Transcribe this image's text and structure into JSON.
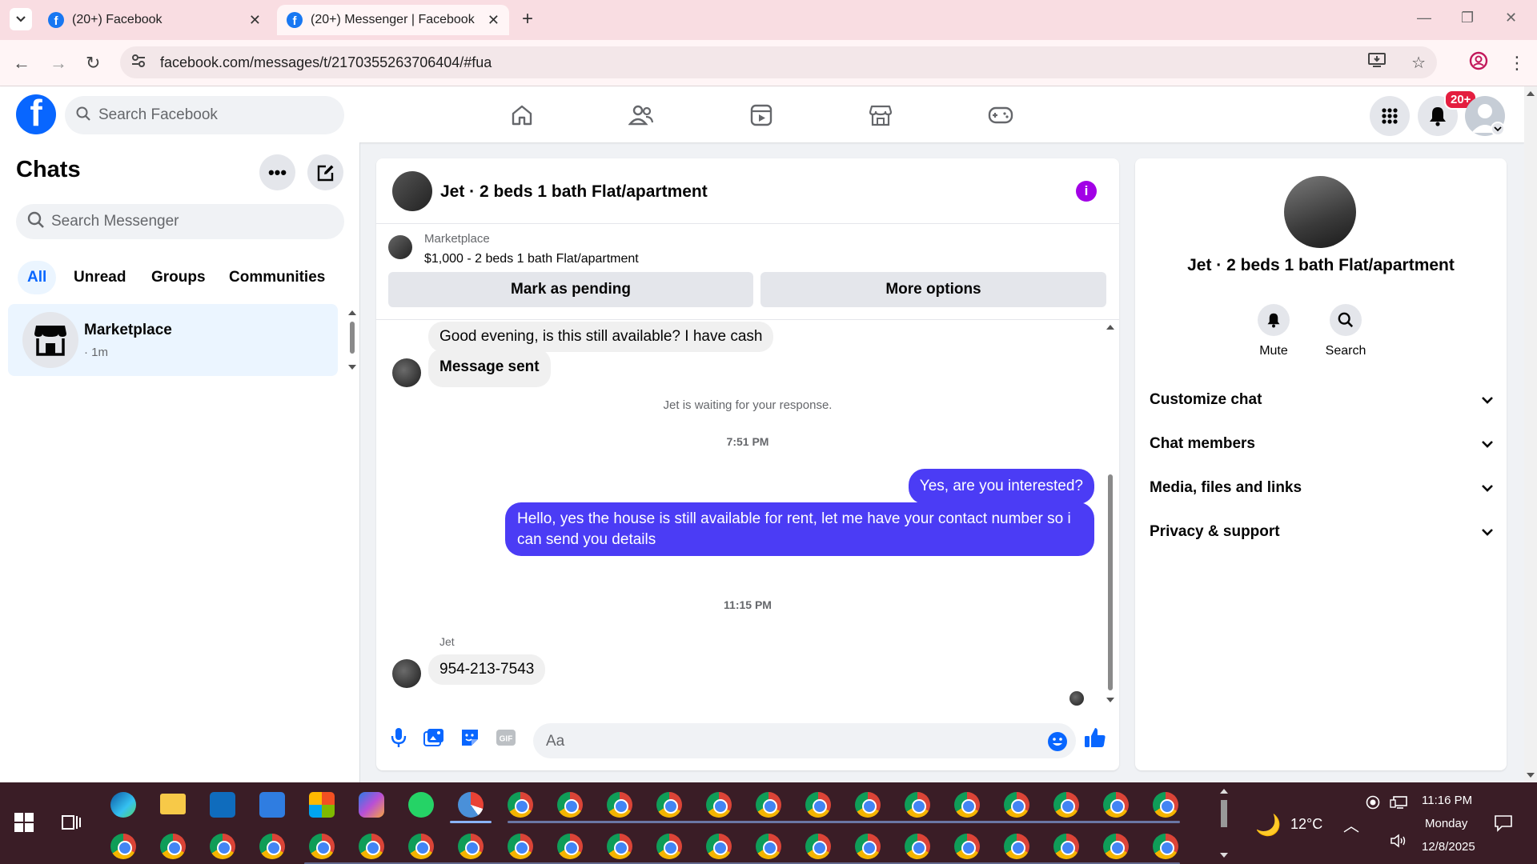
{
  "browser": {
    "tabs": [
      {
        "title": "(20+) Facebook",
        "active": false
      },
      {
        "title": "(20+) Messenger | Facebook",
        "active": true
      }
    ],
    "url": "facebook.com/messages/t/2170355263706404/#fua"
  },
  "header": {
    "search_placeholder": "Search Facebook",
    "notification_count": "20+",
    "nav_items": [
      "home-icon",
      "friends-icon",
      "video-icon",
      "marketplace-icon",
      "gaming-icon"
    ]
  },
  "sidebar": {
    "title": "Chats",
    "search_placeholder": "Search Messenger",
    "filters": [
      "All",
      "Unread",
      "Groups",
      "Communities"
    ],
    "active_filter": "All",
    "conversations": [
      {
        "name": "Marketplace",
        "time": "· 1m"
      }
    ]
  },
  "chat": {
    "title": "Jet · 2 beds 1 bath Flat/apartment",
    "marketplace_label": "Marketplace",
    "listing": "$1,000 - 2 beds 1 bath Flat/apartment",
    "mark_pending_label": "Mark as pending",
    "more_options_label": "More options",
    "messages": {
      "m1": "Good evening, is this still available? I have cash",
      "m2": "Message sent",
      "waiting": "Jet is waiting for your response.",
      "time1": "7:51 PM",
      "m3": "Yes, are you interested?",
      "m4_line1": "Hello, yes the house is still available for rent, let me have your contact number so i",
      "m4_line2": "can send you details",
      "time2": "11:15 PM",
      "sender": "Jet",
      "m5": "954-213-7543"
    },
    "input_placeholder": "Aa"
  },
  "info_panel": {
    "title": "Jet · 2 beds 1 bath Flat/apartment",
    "actions": [
      "Mute",
      "Search"
    ],
    "sections": [
      "Customize chat",
      "Chat members",
      "Media, files and links",
      "Privacy & support"
    ]
  },
  "taskbar": {
    "temperature": "12°C",
    "time": "11:16 PM",
    "day": "Monday",
    "date": "12/8/2025"
  },
  "colors": {
    "fb_blue": "#0866ff",
    "outgoing_bubble": "#4b3cf5",
    "info_purple": "#a200e6",
    "notif_red": "#e41e3f"
  }
}
